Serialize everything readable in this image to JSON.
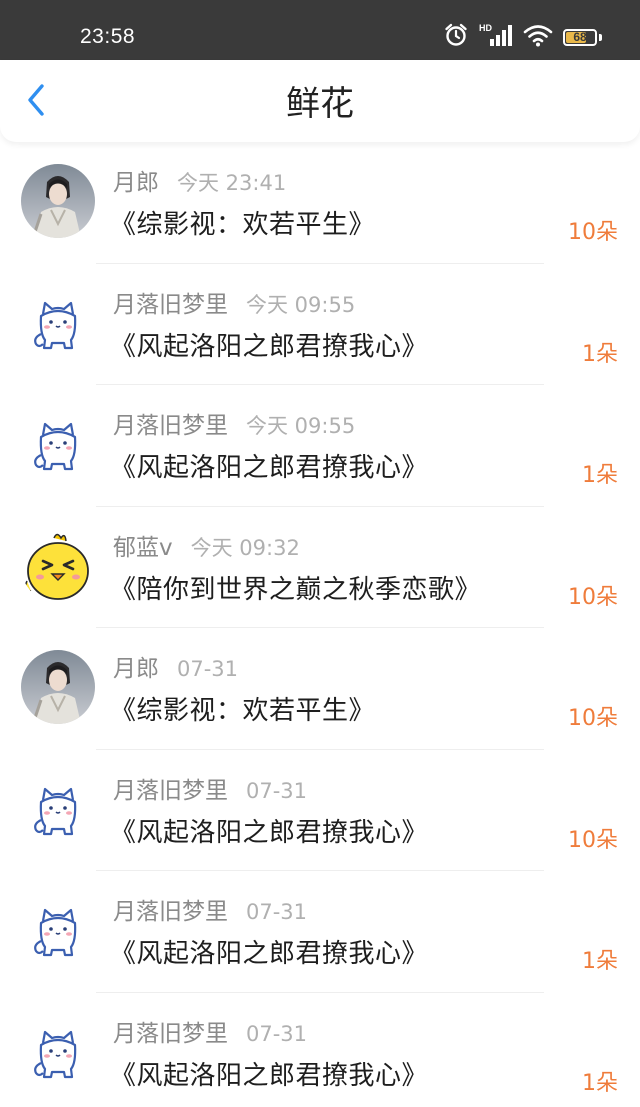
{
  "status_bar": {
    "time": "23:58",
    "battery": "68",
    "network": "HD"
  },
  "header": {
    "title": "鲜花"
  },
  "colors": {
    "accent_blue": "#2f8ff0",
    "count_orange": "#ef7c3b",
    "battery_fill": "#e9b84a"
  },
  "items": [
    {
      "user": "月郎",
      "time": "今天 23:41",
      "book": "《综影视：欢若平生》",
      "count": "10朵",
      "avatar": "photo-avatar"
    },
    {
      "user": "月落旧梦里",
      "time": "今天 09:55",
      "book": "《风起洛阳之郎君撩我心》",
      "count": "1朵",
      "avatar": "cat-avatar"
    },
    {
      "user": "月落旧梦里",
      "time": "今天 09:55",
      "book": "《风起洛阳之郎君撩我心》",
      "count": "1朵",
      "avatar": "cat-avatar"
    },
    {
      "user": "郁蓝v",
      "time": "今天 09:32",
      "book": "《陪你到世界之巅之秋季恋歌》",
      "count": "10朵",
      "avatar": "chick-avatar"
    },
    {
      "user": "月郎",
      "time": "07-31",
      "book": "《综影视：欢若平生》",
      "count": "10朵",
      "avatar": "photo-avatar"
    },
    {
      "user": "月落旧梦里",
      "time": "07-31",
      "book": "《风起洛阳之郎君撩我心》",
      "count": "10朵",
      "avatar": "cat-avatar"
    },
    {
      "user": "月落旧梦里",
      "time": "07-31",
      "book": "《风起洛阳之郎君撩我心》",
      "count": "1朵",
      "avatar": "cat-avatar"
    },
    {
      "user": "月落旧梦里",
      "time": "07-31",
      "book": "《风起洛阳之郎君撩我心》",
      "count": "1朵",
      "avatar": "cat-avatar"
    }
  ]
}
